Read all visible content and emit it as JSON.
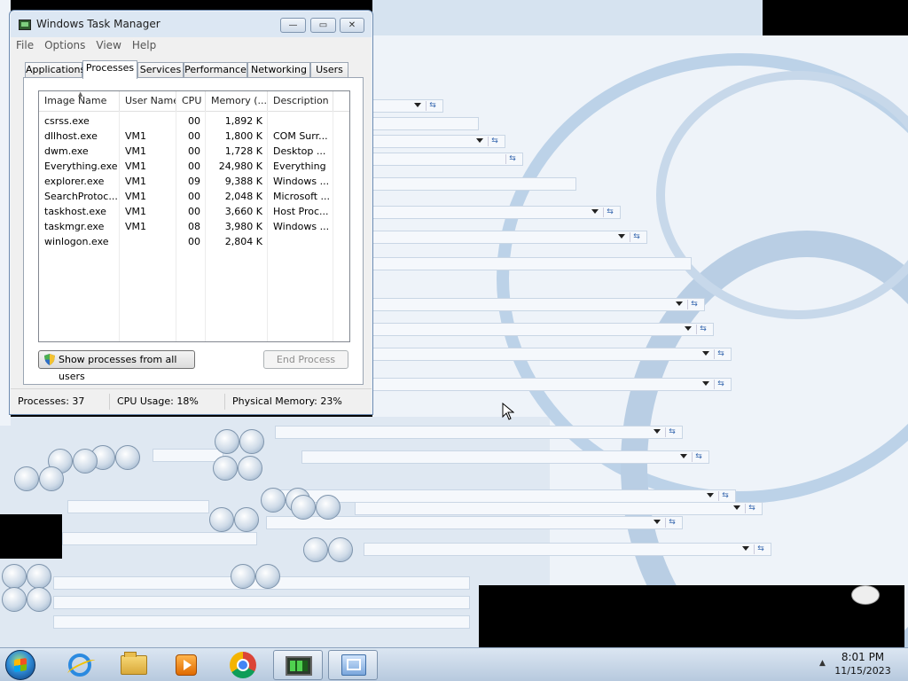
{
  "window": {
    "title": "Windows Task Manager",
    "menu": [
      "File",
      "Options",
      "View",
      "Help"
    ],
    "caption_buttons": {
      "minimize": "—",
      "maximize": "▭",
      "close": "✕"
    }
  },
  "tabs": [
    "Applications",
    "Processes",
    "Services",
    "Performance",
    "Networking",
    "Users"
  ],
  "active_tab": "Processes",
  "processes": {
    "columns": [
      "Image Name",
      "User Name",
      "CPU",
      "Memory (...",
      "Description"
    ],
    "rows": [
      [
        "csrss.exe",
        "",
        "00",
        "1,892 K",
        ""
      ],
      [
        "dllhost.exe",
        "VM1",
        "00",
        "1,800 K",
        "COM Surr..."
      ],
      [
        "dwm.exe",
        "VM1",
        "00",
        "1,728 K",
        "Desktop ..."
      ],
      [
        "Everything.exe",
        "VM1",
        "00",
        "24,980 K",
        "Everything"
      ],
      [
        "explorer.exe",
        "VM1",
        "09",
        "9,388 K",
        "Windows ..."
      ],
      [
        "SearchProtoc...",
        "VM1",
        "00",
        "2,048 K",
        "Microsoft ..."
      ],
      [
        "taskhost.exe",
        "VM1",
        "00",
        "3,660 K",
        "Host Proc..."
      ],
      [
        "taskmgr.exe",
        "VM1",
        "08",
        "3,980 K",
        "Windows ..."
      ],
      [
        "winlogon.exe",
        "",
        "00",
        "2,804 K",
        ""
      ]
    ]
  },
  "buttons": {
    "show_all": "Show processes from all users",
    "end_process": "End Process"
  },
  "status": {
    "processes": "Processes: 37",
    "cpu": "CPU Usage: 18%",
    "memory": "Physical Memory: 23%"
  },
  "taskbar": {
    "apps": [
      "internet-explorer",
      "windows-explorer",
      "media-player",
      "chrome",
      "task-manager",
      "control-panel"
    ],
    "clock_time": "8:01 PM",
    "clock_date": "11/15/2023"
  }
}
